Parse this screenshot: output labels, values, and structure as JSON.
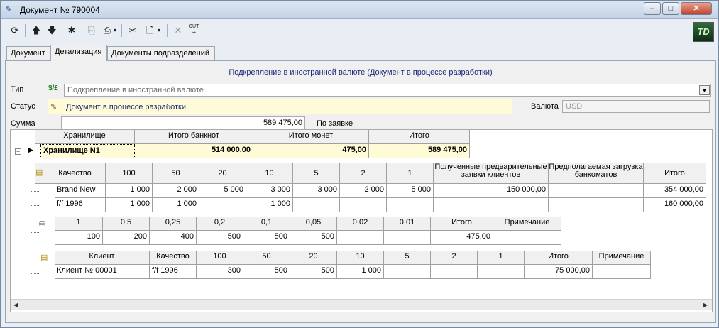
{
  "window": {
    "title": "Документ № 790004"
  },
  "tabs": [
    "Документ",
    "Детализация",
    "Документы подразделений"
  ],
  "header_text": "Подкрепление в иностранной валюте (Документ в процессе разработки)",
  "type": {
    "label": "Тип",
    "icon_text": "$/£",
    "value": "Подкрепление в иностранной валюте"
  },
  "status": {
    "label": "Статус",
    "value": "Документ в процессе разработки"
  },
  "currency": {
    "label": "Валюта",
    "value": "USD"
  },
  "sum": {
    "label": "Сумма",
    "value": "589 475,00",
    "note": "По заявке"
  },
  "main_table": {
    "headers": [
      "Хранилище",
      "Итого банкнот",
      "Итого монет",
      "Итого"
    ],
    "row": [
      "Хранилище N1",
      "514 000,00",
      "475,00",
      "589 475,00"
    ]
  },
  "banknotes": {
    "headers": [
      "Качество",
      "100",
      "50",
      "20",
      "10",
      "5",
      "2",
      "1",
      "Полученные предварительные заявки клиентов",
      "Предполагаемая загрузка банкоматов",
      "Итого"
    ],
    "rows": [
      [
        "Brand New",
        "1 000",
        "2 000",
        "5 000",
        "3 000",
        "3 000",
        "2 000",
        "5 000",
        "150 000,00",
        "",
        "354 000,00"
      ],
      [
        "f/f 1996",
        "1 000",
        "1 000",
        "",
        "1 000",
        "",
        "",
        "",
        "",
        "",
        "160 000,00"
      ]
    ]
  },
  "coins": {
    "headers": [
      "1",
      "0,5",
      "0,25",
      "0,2",
      "0,1",
      "0,05",
      "0,02",
      "0,01",
      "Итого",
      "Примечание"
    ],
    "row": [
      "100",
      "200",
      "400",
      "500",
      "500",
      "500",
      "",
      "",
      "475,00",
      ""
    ]
  },
  "clients": {
    "headers": [
      "Клиент",
      "Качество",
      "100",
      "50",
      "20",
      "10",
      "5",
      "2",
      "1",
      "Итого",
      "Примечание"
    ],
    "row": [
      "Клиент № 00001",
      "f/f 1996",
      "300",
      "500",
      "500",
      "1 000",
      "",
      "",
      "",
      "75 000,00",
      ""
    ]
  },
  "logo_text": "TD",
  "colors": {
    "title_gradient": "#c3d3e6",
    "status_bg": "#fffbd6",
    "header_text": "#1c2b7a"
  }
}
